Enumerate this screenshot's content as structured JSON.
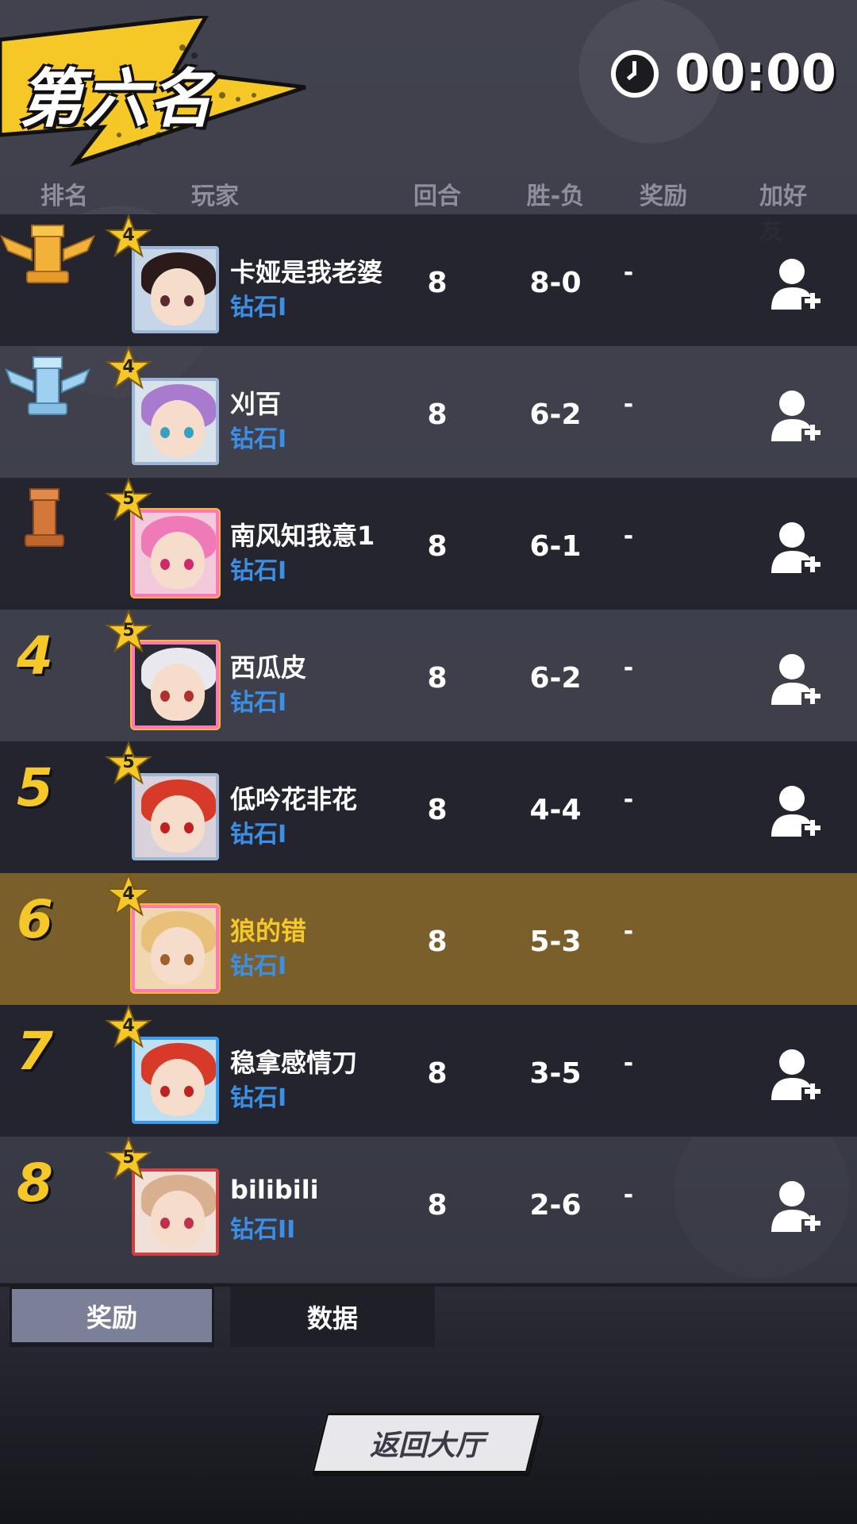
{
  "header": {
    "title": "第六名",
    "timer": "00:00",
    "banner_color": "#f5c828"
  },
  "columns": {
    "rank": "排名",
    "player": "玩家",
    "rounds": "回合",
    "record": "胜-负",
    "reward": "奖励",
    "add_friend": "加好友"
  },
  "players": [
    {
      "rank": "1",
      "rank_icon": "gold-rook-trophy-icon",
      "stars": "4",
      "name": "卡娅是我老婆",
      "tier": "钻石I",
      "rounds": "8",
      "record": "8-0",
      "reward": "-",
      "can_add_friend": true,
      "is_self": false
    },
    {
      "rank": "2",
      "rank_icon": "silver-rook-trophy-icon",
      "stars": "4",
      "name": "刈百",
      "tier": "钻石I",
      "rounds": "8",
      "record": "6-2",
      "reward": "-",
      "can_add_friend": true,
      "is_self": false
    },
    {
      "rank": "3",
      "rank_icon": "bronze-rook-trophy-icon",
      "stars": "5",
      "name": "南风知我意1",
      "tier": "钻石I",
      "rounds": "8",
      "record": "6-1",
      "reward": "-",
      "can_add_friend": true,
      "is_self": false
    },
    {
      "rank": "4",
      "stars": "5",
      "name": "西瓜皮",
      "tier": "钻石I",
      "rounds": "8",
      "record": "6-2",
      "reward": "-",
      "can_add_friend": true,
      "is_self": false
    },
    {
      "rank": "5",
      "stars": "5",
      "name": "低吟花非花",
      "tier": "钻石I",
      "rounds": "8",
      "record": "4-4",
      "reward": "-",
      "can_add_friend": true,
      "is_self": false
    },
    {
      "rank": "6",
      "stars": "4",
      "name": "狼的错",
      "tier": "钻石I",
      "rounds": "8",
      "record": "5-3",
      "reward": "-",
      "can_add_friend": false,
      "is_self": true
    },
    {
      "rank": "7",
      "stars": "4",
      "name": "稳拿感情刀",
      "tier": "钻石I",
      "rounds": "8",
      "record": "3-5",
      "reward": "-",
      "can_add_friend": true,
      "is_self": false
    },
    {
      "rank": "8",
      "stars": "5",
      "name": "bilibili",
      "tier": "钻石II",
      "rounds": "8",
      "record": "2-6",
      "reward": "-",
      "can_add_friend": true,
      "is_self": false
    }
  ],
  "tabs": {
    "rewards": "奖励",
    "stats": "数据",
    "active": "奖励"
  },
  "footer": {
    "back_button": "返回大厅"
  },
  "colors": {
    "rank_number": "#f5c828",
    "tier_text": "#3a8fe6",
    "self_row_bg": "#7a5f2a",
    "self_name": "#f5c828"
  }
}
